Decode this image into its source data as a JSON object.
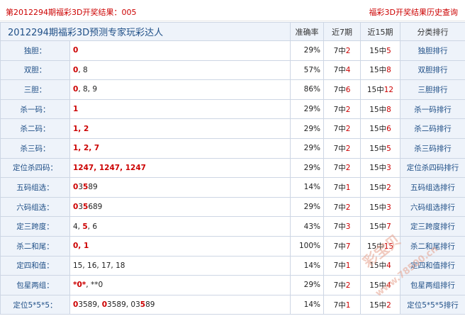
{
  "topbar": {
    "left_text": "第2012294期福彩3D开奖结果：005",
    "right_link": "福彩3D开奖结果历史查询"
  },
  "table": {
    "title": "2012294期福彩3D预测专家玩彩达人",
    "headers": [
      "准确率",
      "近7期",
      "近15期",
      "分类排行"
    ],
    "rows": [
      {
        "label": "独胆：",
        "nums": [
          {
            "t": "0",
            "red": true
          }
        ],
        "rate": "29%",
        "r7": [
          "7中",
          "2"
        ],
        "r15": [
          "15中",
          "5"
        ],
        "rank": "独胆排行"
      },
      {
        "label": "双胆：",
        "nums": [
          {
            "t": "0",
            "red": true
          },
          {
            "t": ", 8",
            "red": false
          }
        ],
        "rate": "57%",
        "r7": [
          "7中",
          "4"
        ],
        "r15": [
          "15中",
          "8"
        ],
        "rank": "双胆排行"
      },
      {
        "label": "三胆：",
        "nums": [
          {
            "t": "0",
            "red": true
          },
          {
            "t": ", 8, 9",
            "red": false
          }
        ],
        "rate": "86%",
        "r7": [
          "7中",
          "6"
        ],
        "r15": [
          "15中",
          "12"
        ],
        "rank": "三胆排行"
      },
      {
        "label": "杀一码：",
        "nums": [
          {
            "t": "1",
            "red": true
          }
        ],
        "rate": "29%",
        "r7": [
          "7中",
          "2"
        ],
        "r15": [
          "15中",
          "8"
        ],
        "rank": "杀一码排行"
      },
      {
        "label": "杀二码：",
        "nums": [
          {
            "t": "1, 2",
            "red": true
          }
        ],
        "rate": "29%",
        "r7": [
          "7中",
          "2"
        ],
        "r15": [
          "15中",
          "6"
        ],
        "rank": "杀二码排行"
      },
      {
        "label": "杀三码：",
        "nums": [
          {
            "t": "1, 2, 7",
            "red": true
          }
        ],
        "rate": "29%",
        "r7": [
          "7中",
          "2"
        ],
        "r15": [
          "15中",
          "5"
        ],
        "rank": "杀三码排行"
      },
      {
        "label": "定位杀四码：",
        "nums": [
          {
            "t": "1247, 1247, 1247",
            "red": true
          }
        ],
        "rate": "29%",
        "r7": [
          "7中",
          "2"
        ],
        "r15": [
          "15中",
          "3"
        ],
        "rank": "定位杀四码排行"
      },
      {
        "label": "五码组选：",
        "nums": [
          {
            "t": "0",
            "red": true
          },
          {
            "t": "3",
            "red": false
          },
          {
            "t": "5",
            "red": true
          },
          {
            "t": "89",
            "red": false
          }
        ],
        "rate": "14%",
        "r7": [
          "7中",
          "1"
        ],
        "r15": [
          "15中",
          "2"
        ],
        "rank": "五码组选排行"
      },
      {
        "label": "六码组选：",
        "nums": [
          {
            "t": "0",
            "red": true
          },
          {
            "t": "3",
            "red": false
          },
          {
            "t": "5",
            "red": true
          },
          {
            "t": "689",
            "red": false
          }
        ],
        "rate": "29%",
        "r7": [
          "7中",
          "2"
        ],
        "r15": [
          "15中",
          "3"
        ],
        "rank": "六码组选排行"
      },
      {
        "label": "定三跨度：",
        "nums": [
          {
            "t": "4, ",
            "red": false
          },
          {
            "t": "5",
            "red": true
          },
          {
            "t": ", 6",
            "red": false
          }
        ],
        "rate": "43%",
        "r7": [
          "7中",
          "3"
        ],
        "r15": [
          "15中",
          "7"
        ],
        "rank": "定三跨度排行"
      },
      {
        "label": "杀二和尾：",
        "nums": [
          {
            "t": "0, 1",
            "red": true
          }
        ],
        "rate": "100%",
        "r7": [
          "7中",
          "7"
        ],
        "r15": [
          "15中",
          "15"
        ],
        "rank": "杀二和尾排行"
      },
      {
        "label": "定四和值：",
        "nums": [
          {
            "t": "15, 16, 17, 18",
            "red": false
          }
        ],
        "rate": "14%",
        "r7": [
          "7中",
          "1"
        ],
        "r15": [
          "15中",
          "4"
        ],
        "rank": "定四和值排行"
      },
      {
        "label": "包星两组：",
        "nums": [
          {
            "t": "*0*",
            "red": true
          },
          {
            "t": ", **0",
            "red": false
          }
        ],
        "rate": "29%",
        "r7": [
          "7中",
          "2"
        ],
        "r15": [
          "15中",
          "4"
        ],
        "rank": "包星两组排行"
      },
      {
        "label": "定位5*5*5：",
        "nums": [
          {
            "t": "0",
            "red": true
          },
          {
            "t": "3589, ",
            "red": false
          },
          {
            "t": "0",
            "red": true
          },
          {
            "t": "3589, 03",
            "red": false
          },
          {
            "t": "5",
            "red": true
          },
          {
            "t": "89",
            "red": false
          }
        ],
        "rate": "14%",
        "r7": [
          "7中",
          "1"
        ],
        "r15": [
          "15中",
          "2"
        ],
        "rank": "定位5*5*5排行"
      }
    ]
  },
  "watermark": {
    "brand": "彩宝贝",
    "url": "www.78500.cn"
  }
}
